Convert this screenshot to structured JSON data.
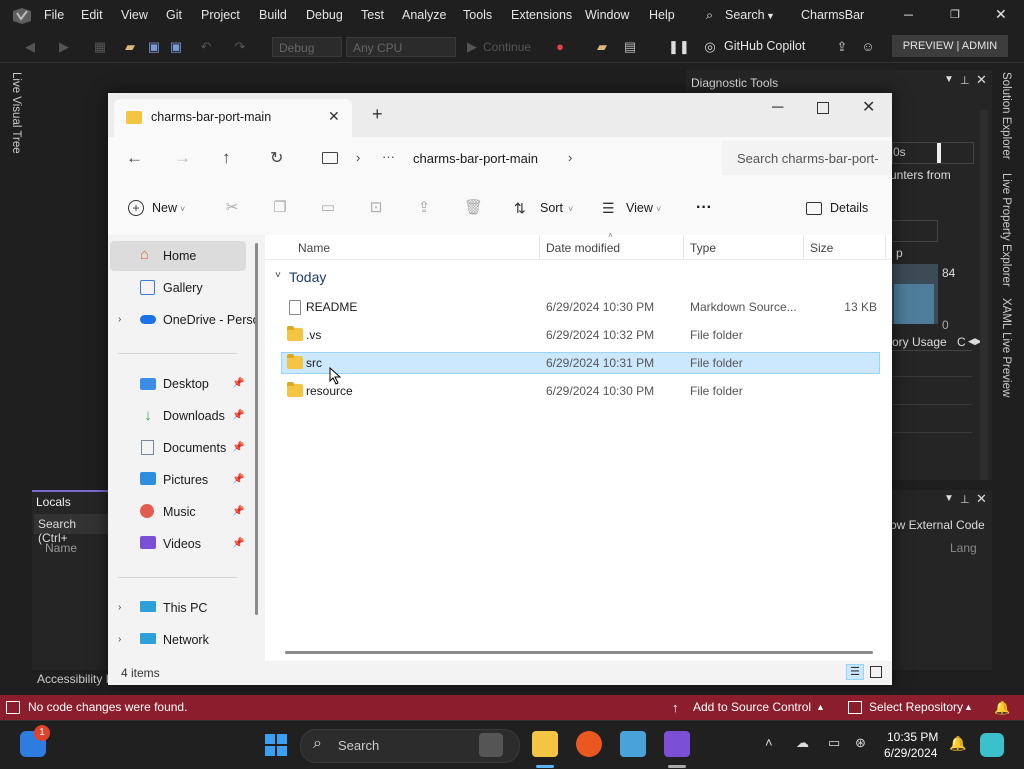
{
  "vs": {
    "menu": [
      "File",
      "Edit",
      "View",
      "Git",
      "Project",
      "Build",
      "Debug",
      "Test",
      "Analyze",
      "Tools",
      "Extensions",
      "Window",
      "Help"
    ],
    "search_label": "Search",
    "solution_name": "CharmsBar",
    "config": "Debug",
    "platform": "Any CPU",
    "continue_label": "Continue",
    "copilot_label": "GitHub Copilot",
    "preview_badge": "PREVIEW | ADMIN",
    "left_vertical": "Live Visual Tree",
    "right_vertical": [
      "Solution Explorer",
      "Live Property Explorer",
      "XAML Live Preview"
    ],
    "diagnostic_title": "Diagnostic Tools",
    "diag_fragments": {
      "time": "0s",
      "counters": "unters from",
      "p": "p",
      "value": "84",
      "zero": "0",
      "memory_tab": "ory Usage",
      "c_tab": "C"
    },
    "locals": {
      "title": "Locals",
      "search": "Search (Ctrl+",
      "col_name": "Name",
      "show_external": "ow External Code",
      "lang": "Lang"
    },
    "accessibility": "Accessibility I",
    "status": {
      "message": "No code changes were found.",
      "add_source": "Add to Source Control",
      "select_repo": "Select Repository"
    }
  },
  "explorer": {
    "tab_title": "charms-bar-port-main",
    "breadcrumb": "charms-bar-port-main",
    "search_placeholder": "Search charms-bar-port-",
    "commands": {
      "new": "New",
      "sort": "Sort",
      "view": "View",
      "more": "···",
      "details": "Details"
    },
    "nav": {
      "home": "Home",
      "gallery": "Gallery",
      "onedrive": "OneDrive - Perso",
      "desktop": "Desktop",
      "downloads": "Downloads",
      "documents": "Documents",
      "pictures": "Pictures",
      "music": "Music",
      "videos": "Videos",
      "this_pc": "This PC",
      "network": "Network"
    },
    "columns": {
      "name": "Name",
      "date": "Date modified",
      "type": "Type",
      "size": "Size"
    },
    "group": "Today",
    "files": [
      {
        "name": "README",
        "date": "6/29/2024 10:30 PM",
        "type": "Markdown Source...",
        "size": "13 KB",
        "kind": "file"
      },
      {
        "name": ".vs",
        "date": "6/29/2024 10:32 PM",
        "type": "File folder",
        "size": "",
        "kind": "folder"
      },
      {
        "name": "src",
        "date": "6/29/2024 10:31 PM",
        "type": "File folder",
        "size": "",
        "kind": "folder"
      },
      {
        "name": "resource",
        "date": "6/29/2024 10:30 PM",
        "type": "File folder",
        "size": "",
        "kind": "folder"
      }
    ],
    "status_items": "4 items"
  },
  "taskbar": {
    "search_label": "Search",
    "time": "10:35 PM",
    "date": "6/29/2024",
    "notification_badge": "1"
  },
  "colors": {
    "vs_status": "#8b1d2c",
    "selection": "#cce8ff",
    "accent": "#0067c0"
  }
}
